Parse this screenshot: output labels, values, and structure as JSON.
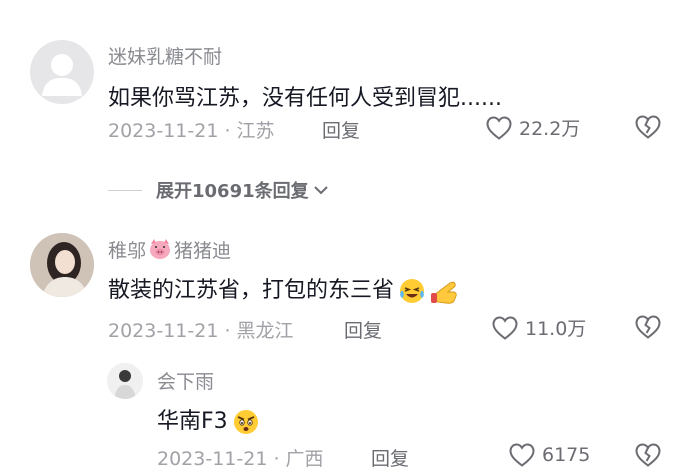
{
  "comments": [
    {
      "username": "迷妹乳糖不耐",
      "text": "如果你骂江苏，没有任何人受到冒犯......",
      "meta": "2023-11-21 · 江苏",
      "reply_label": "回复",
      "likes": "22.2万",
      "avatar_icon": "default-avatar-icon"
    },
    {
      "username": "稚邬",
      "username_suffix": "猪猪迪",
      "username_emoji": "pig-face-icon",
      "text": "散装的江苏省，打包的东三省",
      "text_emojis": [
        "laughing-crying-icon",
        "pointing-hand-icon"
      ],
      "meta": "2023-11-21 · 黑龙江",
      "reply_label": "回复",
      "likes": "11.0万"
    }
  ],
  "expand": {
    "label": "展开10691条回复"
  },
  "sub_reply": {
    "username": "会下雨",
    "text": "华南F3",
    "text_emoji": "angry-face-icon",
    "meta": "2023-11-21 · 广西",
    "reply_label": "回复",
    "likes": "6175"
  },
  "colors": {
    "primary_text": "#161823",
    "secondary_text": "#8a8b91",
    "meta_text": "#a1a2a7",
    "background": "#ffffff"
  }
}
